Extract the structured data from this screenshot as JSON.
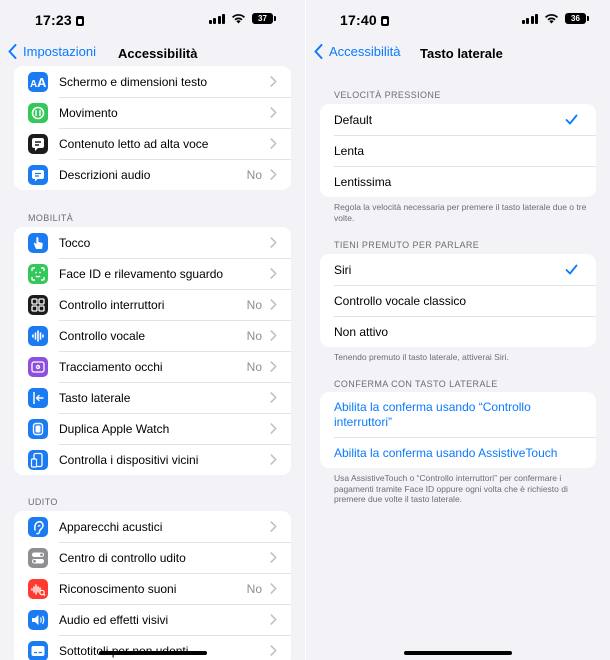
{
  "left": {
    "status": {
      "time": "17:23",
      "battery": "37"
    },
    "nav": {
      "back_label": "Impostazioni",
      "title": "Accessibilità"
    },
    "group_top": [
      {
        "label": "Schermo e dimensioni testo",
        "value": "",
        "icon": "text-size-icon",
        "color": "#1a7bf2"
      },
      {
        "label": "Movimento",
        "value": "",
        "icon": "motion-icon",
        "color": "#34c759"
      },
      {
        "label": "Contenuto letto ad alta voce",
        "value": "",
        "icon": "spoken-content-icon",
        "color": "#1c1c1e"
      },
      {
        "label": "Descrizioni audio",
        "value": "No",
        "icon": "audio-description-icon",
        "color": "#1a7bf2"
      }
    ],
    "mobility": {
      "header": "MOBILITÀ",
      "items": [
        {
          "label": "Tocco",
          "value": "",
          "icon": "touch-icon",
          "color": "#1a7bf2"
        },
        {
          "label": "Face ID e rilevamento sguardo",
          "value": "",
          "icon": "face-id-icon",
          "color": "#34c759"
        },
        {
          "label": "Controllo interruttori",
          "value": "No",
          "icon": "switch-control-icon",
          "color": "#1c1c1e"
        },
        {
          "label": "Controllo vocale",
          "value": "No",
          "icon": "voice-control-icon",
          "color": "#1a7bf2"
        },
        {
          "label": "Tracciamento occhi",
          "value": "No",
          "icon": "eye-tracking-icon",
          "color": "#8e4ee0"
        },
        {
          "label": "Tasto laterale",
          "value": "",
          "icon": "side-button-icon",
          "color": "#1a7bf2"
        },
        {
          "label": "Duplica Apple Watch",
          "value": "",
          "icon": "apple-watch-icon",
          "color": "#1a7bf2"
        },
        {
          "label": "Controlla i dispositivi vicini",
          "value": "",
          "icon": "nearby-devices-icon",
          "color": "#1a7bf2"
        }
      ]
    },
    "hearing": {
      "header": "UDITO",
      "items": [
        {
          "label": "Apparecchi acustici",
          "value": "",
          "icon": "hearing-aid-icon",
          "color": "#1a7bf2"
        },
        {
          "label": "Centro di controllo udito",
          "value": "",
          "icon": "hearing-control-icon",
          "color": "#8e8e93"
        },
        {
          "label": "Riconoscimento suoni",
          "value": "No",
          "icon": "sound-recognition-icon",
          "color": "#ff3b30"
        },
        {
          "label": "Audio ed effetti visivi",
          "value": "",
          "icon": "audio-visual-icon",
          "color": "#1a7bf2"
        },
        {
          "label": "Sottotitoli per non udenti",
          "value": "",
          "icon": "subtitles-icon",
          "color": "#1a7bf2"
        }
      ]
    }
  },
  "right": {
    "status": {
      "time": "17:40",
      "battery": "36"
    },
    "nav": {
      "back_label": "Accessibilità",
      "title": "Tasto laterale"
    },
    "speed": {
      "header": "VELOCITÀ PRESSIONE",
      "options": [
        {
          "label": "Default",
          "selected": true
        },
        {
          "label": "Lenta",
          "selected": false
        },
        {
          "label": "Lentissima",
          "selected": false
        }
      ],
      "footer": "Regola la velocità necessaria per premere il tasto laterale due o tre volte."
    },
    "hold": {
      "header": "TIENI PREMUTO PER PARLARE",
      "options": [
        {
          "label": "Siri",
          "selected": true
        },
        {
          "label": "Controllo vocale classico",
          "selected": false
        },
        {
          "label": "Non attivo",
          "selected": false
        }
      ],
      "footer": "Tenendo premuto il tasto laterale, attiverai Siri."
    },
    "confirm": {
      "header": "CONFERMA CON TASTO LATERALE",
      "links": [
        "Abilita la conferma usando “Controllo interruttori”",
        "Abilita la conferma usando AssistiveTouch"
      ],
      "footer": "Usa AssistiveTouch o “Controllo interruttori” per confermare i pagamenti tramite Face ID oppure ogni volta che è richiesto di premere due volte il tasto laterale."
    }
  },
  "colors": {
    "accent": "#0a7aff",
    "background": "#f2f2f7",
    "card": "#ffffff",
    "secondary_text": "#8e8e93"
  }
}
